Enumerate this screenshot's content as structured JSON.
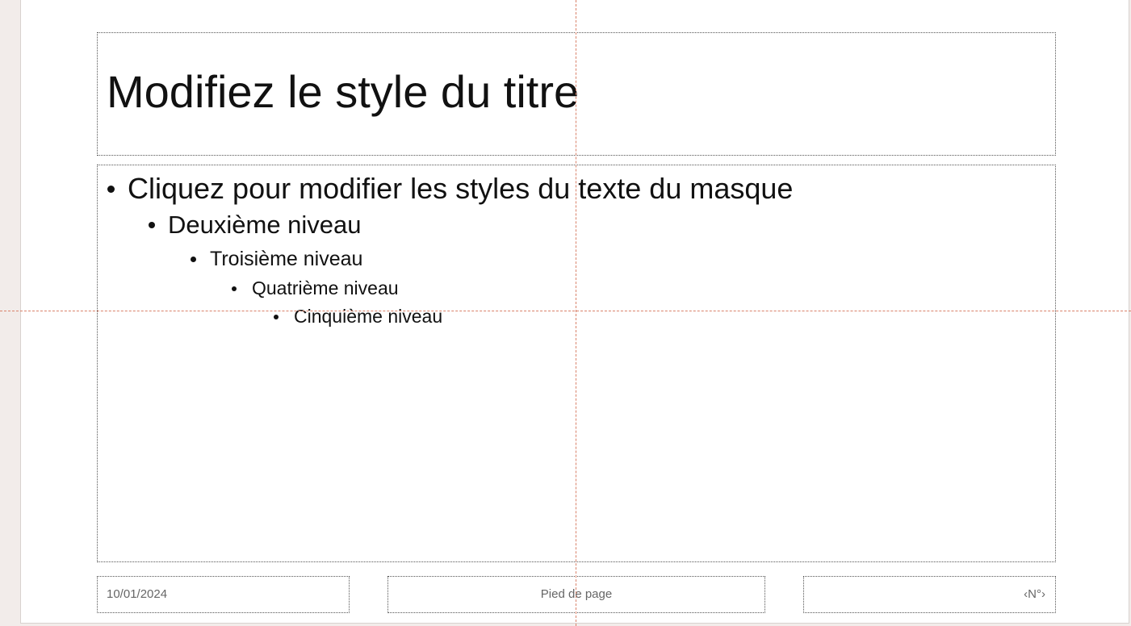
{
  "slide": {
    "title": "Modifiez le style du titre",
    "body_levels": [
      "Cliquez pour modifier les styles du texte du masque",
      "Deuxième niveau",
      "Troisième niveau",
      "Quatrième niveau",
      "Cinquième niveau"
    ],
    "footer": {
      "date": "10/01/2024",
      "footer_text": "Pied de page",
      "slide_number": "‹N°›"
    }
  },
  "colors": {
    "guide": "#d9826a",
    "workspace": "#f2ecea",
    "slide": "#ffffff"
  }
}
